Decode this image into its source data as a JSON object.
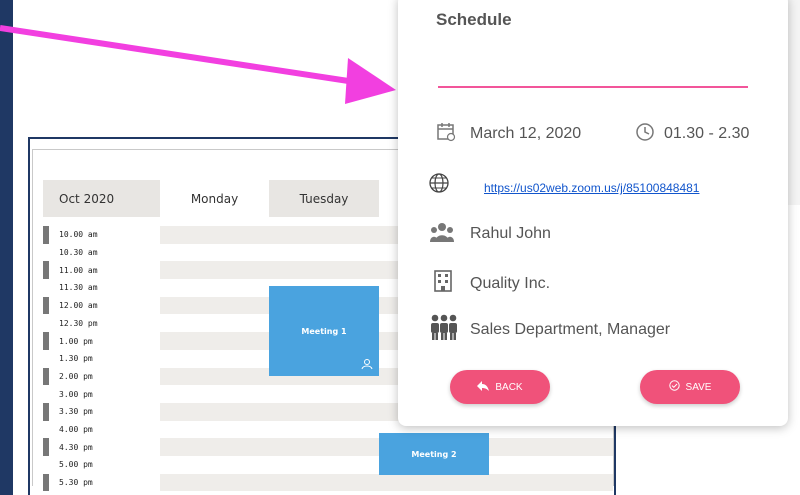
{
  "calendar": {
    "month_label": "Oct 2020",
    "day_headers": [
      "Monday",
      "Tuesday"
    ],
    "times": [
      "10.00 am",
      "10.30 am",
      "11.00 am",
      "11.30 am",
      "12.00 am",
      "12.30 pm",
      "1.00 pm",
      "1.30 pm",
      "2.00 pm",
      "3.00 pm",
      "3.30 pm",
      "4.00 pm",
      "4.30 pm",
      "5.00 pm",
      "5.30 pm"
    ],
    "meetings": [
      {
        "label": "Meeting 1"
      },
      {
        "label": "Meeting 2"
      }
    ]
  },
  "dialog": {
    "title": "Schedule",
    "date": "March 12, 2020",
    "time": "01.30 - 2.30",
    "link": "https://us02web.zoom.us/j/85100848481",
    "person": "Rahul John",
    "company": "Quality Inc.",
    "department": "Sales Department, Manager",
    "back_label": "BACK",
    "save_label": "SAVE"
  },
  "colors": {
    "accent": "#f0527a",
    "arrow": "#f23fe0",
    "meeting": "#4aa3df",
    "frame": "#1f3864"
  },
  "icons": [
    "calendar-icon",
    "clock-icon",
    "globe-icon",
    "people-icon",
    "building-icon",
    "group-icon",
    "back-arrow-icon",
    "check-circle-icon"
  ]
}
